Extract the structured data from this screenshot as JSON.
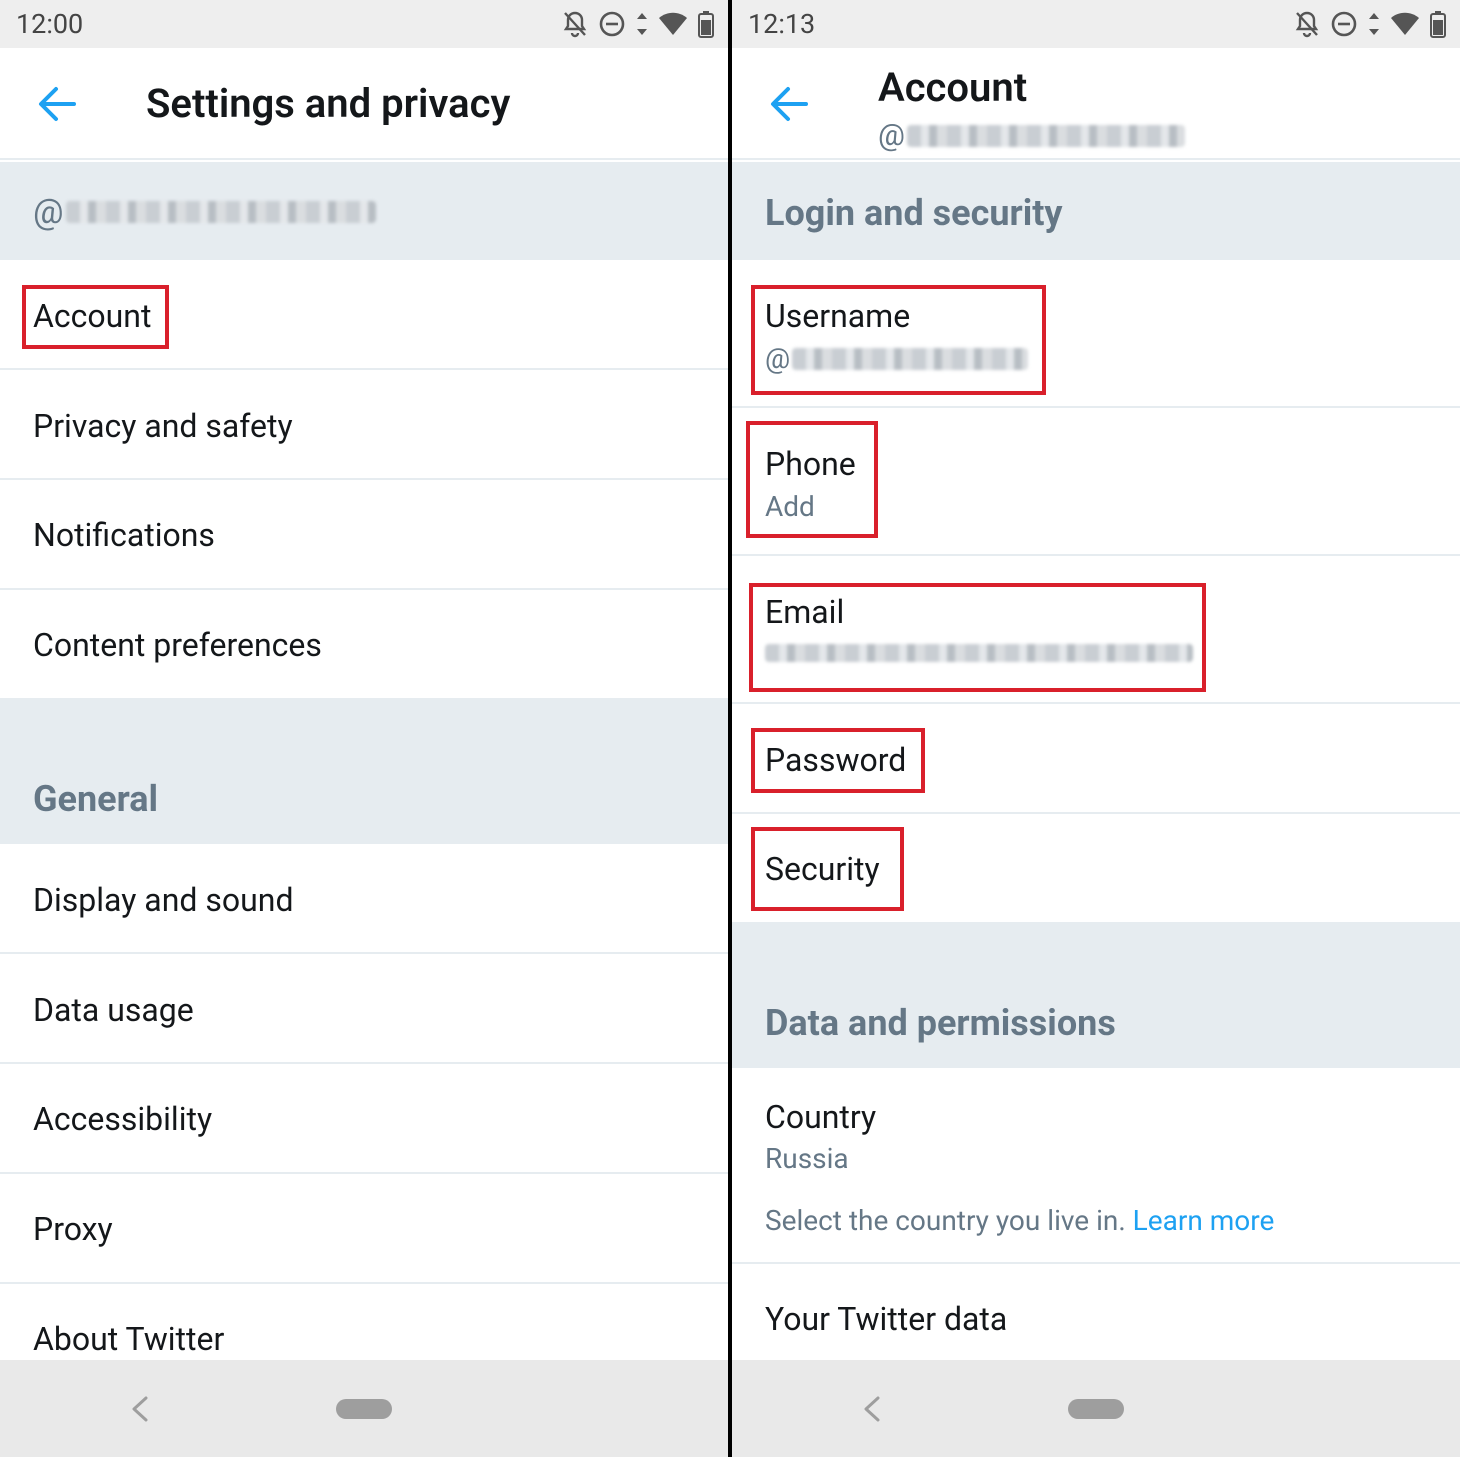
{
  "left": {
    "status": {
      "time": "12:00"
    },
    "header": {
      "title": "Settings and privacy"
    },
    "account_handle_prefix": "@",
    "items_top": [
      {
        "label": "Account"
      },
      {
        "label": "Privacy and safety"
      },
      {
        "label": "Notifications"
      },
      {
        "label": "Content preferences"
      }
    ],
    "general_header": "General",
    "items_general": [
      {
        "label": "Display and sound"
      },
      {
        "label": "Data usage"
      },
      {
        "label": "Accessibility"
      },
      {
        "label": "Proxy"
      },
      {
        "label": "About Twitter"
      }
    ]
  },
  "right": {
    "status": {
      "time": "12:13"
    },
    "header": {
      "title": "Account",
      "subtitle_prefix": "@"
    },
    "login_header": "Login and security",
    "username": {
      "label": "Username",
      "value_prefix": "@"
    },
    "phone": {
      "label": "Phone",
      "value": "Add"
    },
    "email": {
      "label": "Email"
    },
    "password": {
      "label": "Password"
    },
    "security": {
      "label": "Security"
    },
    "data_header": "Data and permissions",
    "country": {
      "label": "Country",
      "value": "Russia",
      "description": "Select the country you live in.",
      "link": "Learn more"
    },
    "twitter_data": {
      "label": "Your Twitter data"
    }
  },
  "colors": {
    "accent": "#1da1f2",
    "highlight": "#d9202b",
    "section_bg": "#e6ecf0",
    "secondary_text": "#657786"
  }
}
